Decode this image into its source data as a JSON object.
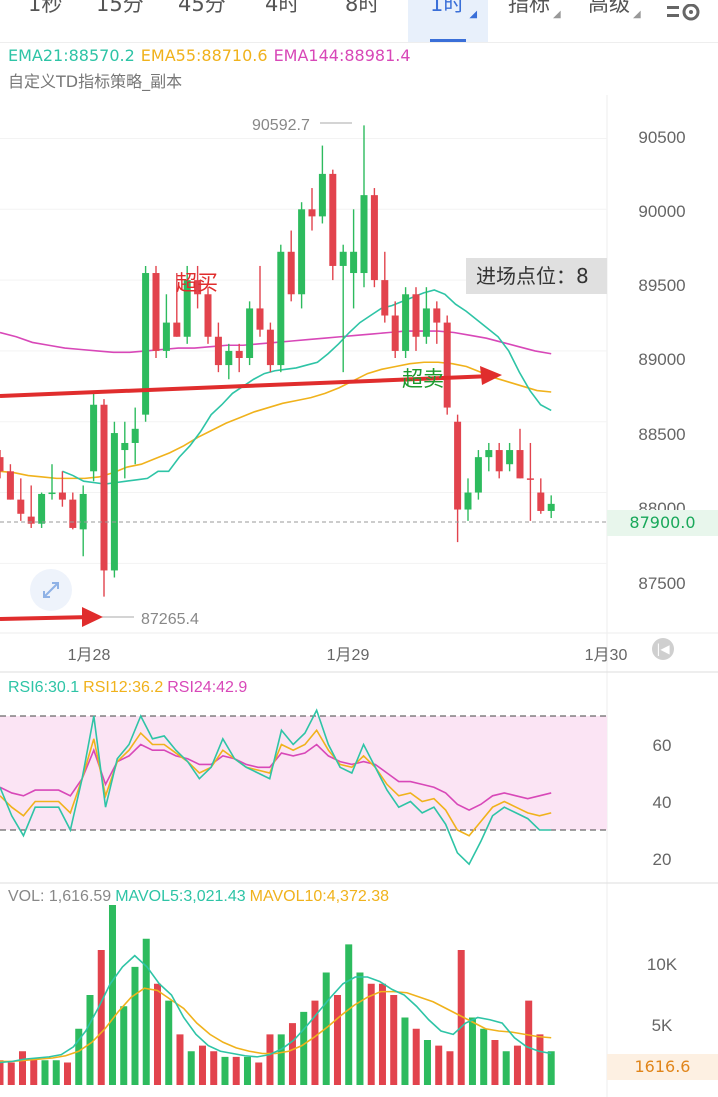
{
  "tabs": [
    {
      "label": "1秒",
      "dropdown": false,
      "active": false
    },
    {
      "label": "15分",
      "dropdown": false,
      "active": false
    },
    {
      "label": "45分",
      "dropdown": false,
      "active": false
    },
    {
      "label": "4时",
      "dropdown": false,
      "active": false
    },
    {
      "label": "8时",
      "dropdown": false,
      "active": false
    },
    {
      "label": "1时",
      "dropdown": true,
      "active": true
    },
    {
      "label": "指标",
      "dropdown": true,
      "active": false
    },
    {
      "label": "高级",
      "dropdown": true,
      "active": false
    }
  ],
  "settings_icon": "settings-sliders-icon",
  "main_legend": {
    "ema21": "EMA21:88570.2",
    "ema55": "EMA55:88710.6",
    "ema144": "EMA144:88981.4",
    "subtitle": "自定义TD指标策略_副本"
  },
  "colors": {
    "up": "#2dbb5e",
    "down": "#e2434d",
    "ema21": "#2ec4a6",
    "ema55": "#f0b21c",
    "ema144": "#d848b8",
    "rsi6": "#2ec4a6",
    "rsi12": "#f0b21c",
    "rsi24": "#d848b8",
    "arrow": "#e02d2d",
    "overbought_text": "#e02d2d",
    "oversold_text": "#1c9a2e",
    "current_price_text": "#19a85a",
    "current_vol_text": "#e0851a"
  },
  "price_axis": {
    "ticks": [
      "90500",
      "90000",
      "89500",
      "89000",
      "88500",
      "88000",
      "87500"
    ]
  },
  "date_axis": {
    "labels": [
      "1月28",
      "1月29",
      "1月30"
    ]
  },
  "annotations": {
    "high_label": "90592.7",
    "low_label": "87265.4",
    "overbought": "超买",
    "oversold": "超卖",
    "entry_label": "进场点位：8",
    "current_price": "87900.0"
  },
  "rsi_legend": {
    "rsi6": "RSI6:30.1",
    "rsi12": "RSI12:36.2",
    "rsi24": "RSI24:42.9"
  },
  "rsi_axis": {
    "ticks": [
      "60",
      "40",
      "20"
    ]
  },
  "vol_legend": {
    "vol": "VOL: 1,616.59",
    "mavol5": "MAVOL5:3,021.43",
    "mavol10": "MAVOL10:4,372.38"
  },
  "vol_axis": {
    "ticks": [
      "10K",
      "5K"
    ],
    "current": "1616.6"
  },
  "chart_data": {
    "type": "candlestick",
    "price_range": [
      87100,
      90800
    ],
    "candles": [
      {
        "o": 88250,
        "h": 88300,
        "l": 88100,
        "c": 88150,
        "up": false
      },
      {
        "o": 88150,
        "h": 88200,
        "l": 87950,
        "c": 87950,
        "up": false
      },
      {
        "o": 87950,
        "h": 88100,
        "l": 87800,
        "c": 87850,
        "up": false
      },
      {
        "o": 87830,
        "h": 88050,
        "l": 87750,
        "c": 87780,
        "up": false
      },
      {
        "o": 87780,
        "h": 88000,
        "l": 87750,
        "c": 87990,
        "up": true
      },
      {
        "o": 88000,
        "h": 88200,
        "l": 87950,
        "c": 88000,
        "up": true
      },
      {
        "o": 88000,
        "h": 88150,
        "l": 87900,
        "c": 87950,
        "up": false
      },
      {
        "o": 87950,
        "h": 88000,
        "l": 87740,
        "c": 87750,
        "up": false
      },
      {
        "o": 87740,
        "h": 88050,
        "l": 87550,
        "c": 87990,
        "up": true
      },
      {
        "o": 88150,
        "h": 88700,
        "l": 88080,
        "c": 88620,
        "up": true
      },
      {
        "o": 88620,
        "h": 88660,
        "l": 87265,
        "c": 87450,
        "up": false
      },
      {
        "o": 87450,
        "h": 88500,
        "l": 87400,
        "c": 88420,
        "up": true
      },
      {
        "o": 88300,
        "h": 88500,
        "l": 88100,
        "c": 88350,
        "up": true
      },
      {
        "o": 88350,
        "h": 88600,
        "l": 88200,
        "c": 88450,
        "up": true
      },
      {
        "o": 88550,
        "h": 89600,
        "l": 88500,
        "c": 89550,
        "up": true
      },
      {
        "o": 89550,
        "h": 89600,
        "l": 88950,
        "c": 89000,
        "up": false
      },
      {
        "o": 89000,
        "h": 89400,
        "l": 88950,
        "c": 89200,
        "up": true
      },
      {
        "o": 89200,
        "h": 89550,
        "l": 89100,
        "c": 89100,
        "up": false
      },
      {
        "o": 89100,
        "h": 89600,
        "l": 89050,
        "c": 89500,
        "up": true
      },
      {
        "o": 89500,
        "h": 89600,
        "l": 89300,
        "c": 89400,
        "up": false
      },
      {
        "o": 89400,
        "h": 89450,
        "l": 89050,
        "c": 89100,
        "up": false
      },
      {
        "o": 89100,
        "h": 89200,
        "l": 88850,
        "c": 88900,
        "up": false
      },
      {
        "o": 88900,
        "h": 89050,
        "l": 88800,
        "c": 89000,
        "up": true
      },
      {
        "o": 89000,
        "h": 89050,
        "l": 88850,
        "c": 88950,
        "up": false
      },
      {
        "o": 88950,
        "h": 89350,
        "l": 88900,
        "c": 89300,
        "up": true
      },
      {
        "o": 89300,
        "h": 89600,
        "l": 89100,
        "c": 89150,
        "up": false
      },
      {
        "o": 89150,
        "h": 89200,
        "l": 88850,
        "c": 88900,
        "up": false
      },
      {
        "o": 88900,
        "h": 89750,
        "l": 88850,
        "c": 89700,
        "up": true
      },
      {
        "o": 89700,
        "h": 89850,
        "l": 89350,
        "c": 89400,
        "up": false
      },
      {
        "o": 89400,
        "h": 90050,
        "l": 89300,
        "c": 90000,
        "up": true
      },
      {
        "o": 90000,
        "h": 90150,
        "l": 89850,
        "c": 89950,
        "up": false
      },
      {
        "o": 89950,
        "h": 90450,
        "l": 89900,
        "c": 90250,
        "up": true
      },
      {
        "o": 90250,
        "h": 90280,
        "l": 89500,
        "c": 89600,
        "up": false
      },
      {
        "o": 89600,
        "h": 89750,
        "l": 88850,
        "c": 89700,
        "up": true
      },
      {
        "o": 89700,
        "h": 90000,
        "l": 89300,
        "c": 89550,
        "up": true
      },
      {
        "o": 89550,
        "h": 90593,
        "l": 89450,
        "c": 90100,
        "up": true
      },
      {
        "o": 90100,
        "h": 90150,
        "l": 89450,
        "c": 89500,
        "up": false
      },
      {
        "o": 89500,
        "h": 89700,
        "l": 89200,
        "c": 89250,
        "up": false
      },
      {
        "o": 89250,
        "h": 89350,
        "l": 88950,
        "c": 89000,
        "up": false
      },
      {
        "o": 89000,
        "h": 89450,
        "l": 88950,
        "c": 89400,
        "up": true
      },
      {
        "o": 89400,
        "h": 89450,
        "l": 89000,
        "c": 89100,
        "up": false
      },
      {
        "o": 89100,
        "h": 89450,
        "l": 89050,
        "c": 89300,
        "up": true
      },
      {
        "o": 89300,
        "h": 89350,
        "l": 89050,
        "c": 89200,
        "up": false
      },
      {
        "o": 89200,
        "h": 89250,
        "l": 88550,
        "c": 88600,
        "up": false
      },
      {
        "o": 88500,
        "h": 88550,
        "l": 87650,
        "c": 87880,
        "up": false
      },
      {
        "o": 87880,
        "h": 88100,
        "l": 87800,
        "c": 88000,
        "up": true
      },
      {
        "o": 88000,
        "h": 88300,
        "l": 87950,
        "c": 88250,
        "up": true
      },
      {
        "o": 88250,
        "h": 88350,
        "l": 88150,
        "c": 88300,
        "up": true
      },
      {
        "o": 88300,
        "h": 88350,
        "l": 88100,
        "c": 88150,
        "up": false
      },
      {
        "o": 88200,
        "h": 88350,
        "l": 88150,
        "c": 88300,
        "up": true
      },
      {
        "o": 88300,
        "h": 88450,
        "l": 88100,
        "c": 88100,
        "up": false
      },
      {
        "o": 88100,
        "h": 88350,
        "l": 87800,
        "c": 88100,
        "up": false
      },
      {
        "o": 88000,
        "h": 88100,
        "l": 87850,
        "c": 87870,
        "up": false
      },
      {
        "o": 87870,
        "h": 87980,
        "l": 87820,
        "c": 87920,
        "up": true
      }
    ],
    "ema21": [
      88150,
      88120,
      88080,
      88070,
      88060,
      88070,
      88080,
      88090,
      88100,
      88150,
      88150,
      88250,
      88330,
      88430,
      88550,
      88620,
      88700,
      88750,
      88800,
      88840,
      88860,
      88870,
      88880,
      88900,
      88920,
      88980,
      89050,
      89130,
      89200,
      89250,
      89300,
      89320,
      89350,
      89380,
      89410,
      89430,
      89400,
      89330,
      89280,
      89220,
      89160,
      89100,
      89000,
      88850,
      88720,
      88620,
      88580
    ],
    "ema55": [
      88150,
      88140,
      88120,
      88110,
      88100,
      88100,
      88100,
      88110,
      88140,
      88180,
      88200,
      88240,
      88280,
      88330,
      88390,
      88440,
      88490,
      88530,
      88570,
      88600,
      88630,
      88650,
      88670,
      88700,
      88740,
      88790,
      88840,
      88870,
      88890,
      88910,
      88920,
      88920,
      88910,
      88890,
      88850,
      88810,
      88780,
      88750,
      88720,
      88710
    ],
    "ema144": [
      89130,
      89100,
      89060,
      89040,
      89020,
      89010,
      89000,
      88990,
      88990,
      89000,
      89010,
      89020,
      89020,
      89030,
      89040,
      89040,
      89050,
      89060,
      89070,
      89080,
      89090,
      89100,
      89110,
      89120,
      89130,
      89140,
      89140,
      89140,
      89130,
      89110,
      89090,
      89060,
      89030,
      89000,
      88980
    ],
    "rsi_range": [
      13,
      78
    ],
    "rsi6": [
      45,
      35,
      28,
      38,
      38,
      38,
      30,
      48,
      70,
      38,
      55,
      60,
      70,
      62,
      63,
      58,
      54,
      48,
      52,
      62,
      55,
      52,
      50,
      48,
      65,
      60,
      64,
      72,
      60,
      52,
      50,
      60,
      52,
      44,
      38,
      40,
      36,
      38,
      32,
      22,
      18,
      26,
      35,
      38,
      36,
      34,
      30,
      30
    ],
    "rsi12": [
      42,
      38,
      35,
      40,
      40,
      40,
      36,
      48,
      62,
      42,
      54,
      58,
      64,
      60,
      60,
      57,
      54,
      50,
      52,
      58,
      55,
      52,
      51,
      50,
      60,
      58,
      60,
      65,
      58,
      53,
      52,
      56,
      52,
      46,
      42,
      43,
      40,
      41,
      37,
      30,
      28,
      33,
      38,
      40,
      38,
      36,
      35,
      36
    ],
    "rsi24": [
      45,
      43,
      42,
      44,
      44,
      44,
      42,
      48,
      58,
      46,
      54,
      56,
      60,
      58,
      58,
      56,
      55,
      53,
      53,
      56,
      55,
      53,
      52,
      52,
      57,
      56,
      57,
      60,
      56,
      54,
      53,
      54,
      53,
      50,
      47,
      47,
      46,
      45,
      43,
      39,
      37,
      39,
      42,
      43,
      42,
      41,
      42,
      43
    ],
    "vol_range": [
      0,
      16000
    ],
    "volumes": [
      2200,
      2000,
      3000,
      2400,
      2200,
      2200,
      2000,
      5000,
      8000,
      12000,
      16000,
      7000,
      10500,
      13000,
      9000,
      7500,
      4500,
      3000,
      3500,
      3000,
      2500,
      2500,
      2500,
      2000,
      4500,
      4500,
      5500,
      6500,
      7500,
      10000,
      8000,
      12500,
      10000,
      9000,
      9000,
      8000,
      6000,
      5000,
      4000,
      3500,
      3000,
      12000,
      6000,
      5000,
      4000,
      3000,
      3500,
      7500,
      4500,
      3000
    ],
    "mavol5": [
      2000,
      2100,
      2300,
      2400,
      2500,
      2700,
      3400,
      4800,
      6800,
      9000,
      10500,
      11500,
      10500,
      9000,
      8000,
      6000,
      4500,
      3500,
      3000,
      2800,
      2600,
      2500,
      2700,
      3200,
      4000,
      5200,
      6500,
      7800,
      9000,
      9600,
      9600,
      9200,
      8500,
      8000,
      7000,
      5800,
      4800,
      4500,
      5500,
      6000,
      5800,
      5500,
      4200,
      3400,
      3000,
      2800
    ],
    "mavol10": [
      2100,
      2100,
      2200,
      2300,
      2400,
      2600,
      3000,
      3800,
      5000,
      6500,
      7800,
      8600,
      8400,
      7600,
      6800,
      5500,
      4500,
      3800,
      3300,
      3000,
      2800,
      2800,
      3000,
      3500,
      4300,
      5200,
      6200,
      7100,
      7800,
      8300,
      8300,
      8200,
      7800,
      7400,
      6800,
      6200,
      5600,
      5000,
      4800,
      4700,
      4500,
      4300,
      4200
    ]
  }
}
